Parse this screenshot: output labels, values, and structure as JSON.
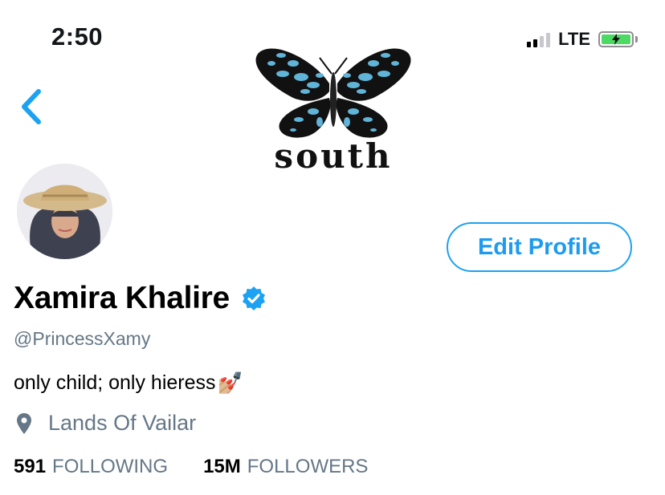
{
  "status_bar": {
    "time": "2:50",
    "network": "LTE"
  },
  "header": {
    "banner_text": "south"
  },
  "profile": {
    "edit_label": "Edit Profile",
    "name": "Xamira Khalire",
    "handle": "@PrincessXamy",
    "bio": "only child; only hieress",
    "bio_emoji": "💅🏼",
    "location": "Lands Of Vailar",
    "following_count": "591",
    "following_label": "FOLLOWING",
    "followers_count": "15M",
    "followers_label": "FOLLOWERS"
  },
  "icons": {
    "back": "chevron-left-icon",
    "verified": "verified-badge-icon",
    "location": "location-pin-icon",
    "banner": "butterfly-icon"
  },
  "colors": {
    "accent": "#1da1f2",
    "secondary_text": "#657786",
    "battery": "#4cd964"
  }
}
